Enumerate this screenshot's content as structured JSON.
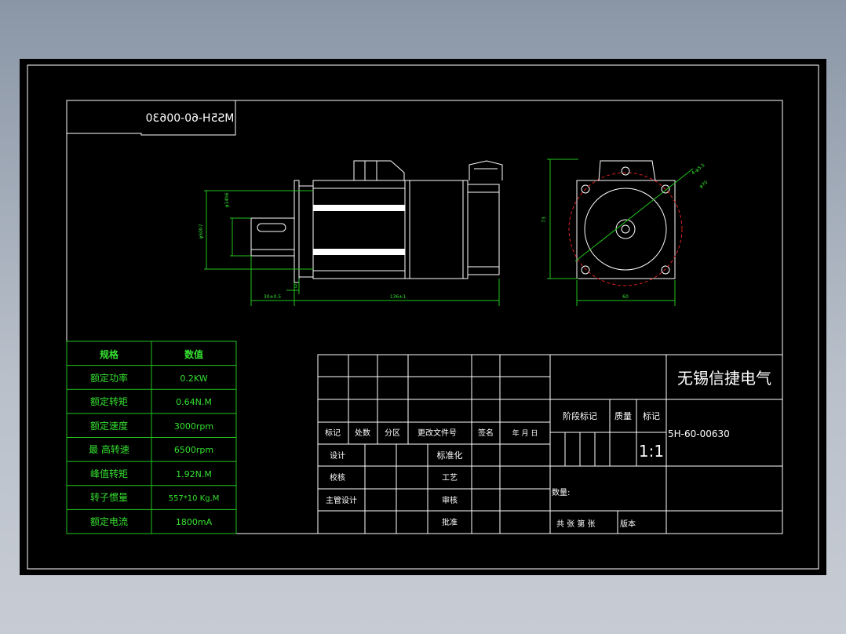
{
  "drawing": {
    "model_label": "MS5H-60-00630",
    "company": "无锡信捷电气",
    "part_code": "5H-60-00630",
    "scale": "1:1",
    "quantity_label": "数量:",
    "sheet_info": "共   张 第   张",
    "version_label": "版本"
  },
  "spec_table": {
    "header": [
      "规格",
      "数值"
    ],
    "rows": [
      [
        "额定功率",
        "0.2KW"
      ],
      [
        "额定转矩",
        "0.64N.M"
      ],
      [
        "额定速度",
        "3000rpm"
      ],
      [
        "最  高转速",
        "6500rpm"
      ],
      [
        "峰值转矩",
        "1.92N.M"
      ],
      [
        "转子惯量",
        "557*10  Kg.M"
      ],
      [
        "额定电流",
        "1800mA"
      ]
    ]
  },
  "title_block": {
    "header_row": [
      "标记",
      "处数",
      "分区",
      "更改文件号",
      "签名",
      "年  月  日"
    ],
    "phase_labels": [
      "阶段标记",
      "质量",
      "标记"
    ],
    "left_labels": [
      "设计",
      "校核",
      "主管设计"
    ],
    "mid_labels": [
      "标准化",
      "工艺",
      "审核",
      "批准"
    ]
  },
  "dimensions": {
    "d_shaft": "φ14h6",
    "d_pilot": "φ50h7",
    "len_shaft": "30±0.5",
    "len_body": "136±1",
    "flange_gap": "3",
    "height": "73",
    "width": "60",
    "hole": "4-φ5.5",
    "pcd": "φ70"
  }
}
